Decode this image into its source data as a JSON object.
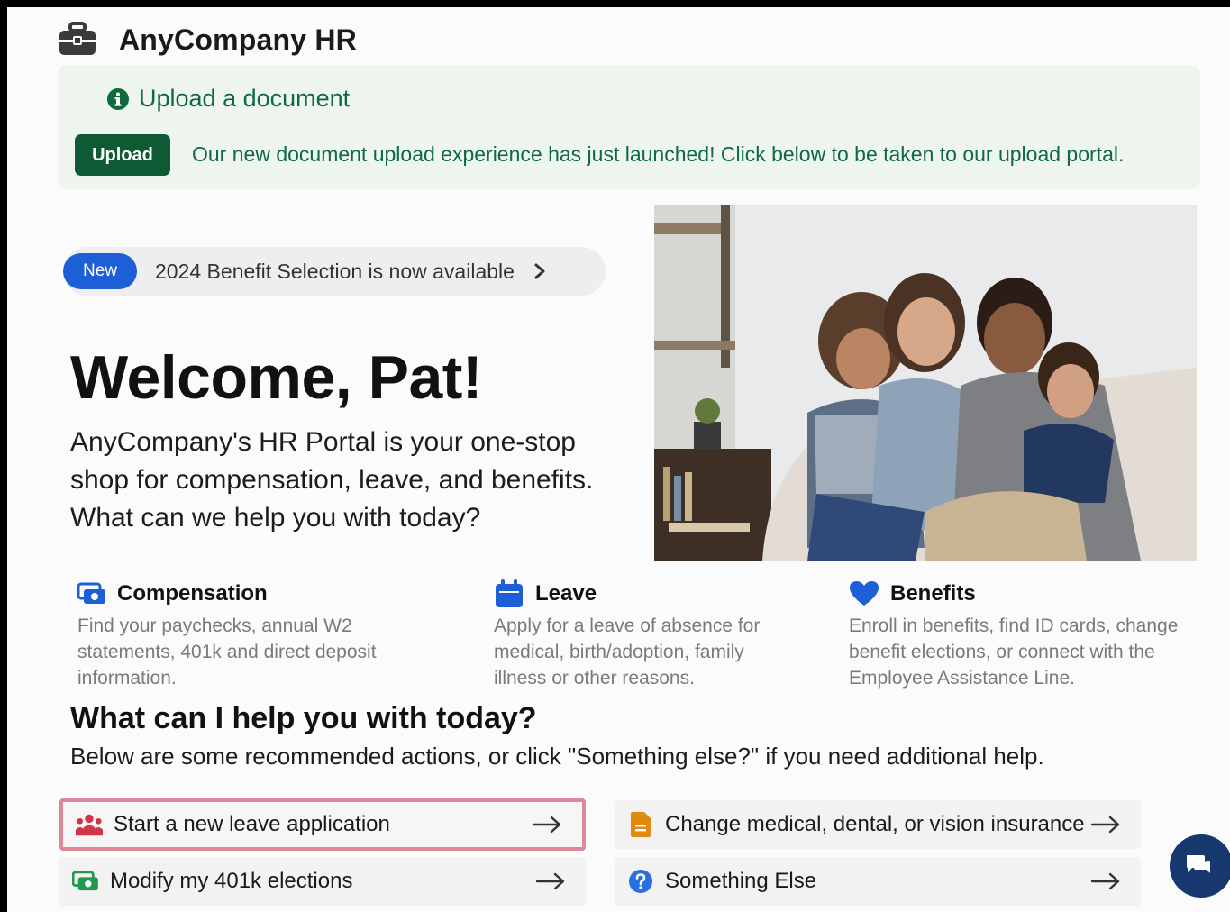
{
  "header": {
    "title": "AnyCompany HR",
    "icon": "briefcase-icon"
  },
  "alert": {
    "title": "Upload a document",
    "button_label": "Upload",
    "message": "Our new document upload experience has just launched! Click below to be taken to our upload portal.",
    "colors": {
      "background": "#eef5ef",
      "text": "#0f6a3c",
      "button": "#0e5a35"
    }
  },
  "announcement": {
    "badge": "New",
    "text": "2024 Benefit Selection is now available",
    "badge_color": "#1d5fd6"
  },
  "welcome": {
    "heading": "Welcome, Pat!",
    "intro_lines": [
      "AnyCompany's HR Portal is your one-stop",
      "shop for compensation, leave, and benefits.",
      "What can we help you with today?"
    ]
  },
  "categories": [
    {
      "title": "Compensation",
      "icon": "money-icon",
      "lines": [
        "Find your paychecks, annual W2",
        "statements, 401k and direct deposit",
        "information."
      ]
    },
    {
      "title": "Leave",
      "icon": "calendar-icon",
      "lines": [
        "Apply for a leave of absence for",
        "medical, birth/adoption, family",
        "illness or other reasons."
      ]
    },
    {
      "title": "Benefits",
      "icon": "heart-icon",
      "lines": [
        "Enroll in benefits, find ID cards, change",
        "benefit elections, or connect with the",
        "Employee Assistance Line."
      ]
    }
  ],
  "help": {
    "title": "What can I help you with today?",
    "subtitle": "Below are some recommended actions, or click \"Something else?\" if you need additional help."
  },
  "actions": [
    {
      "label": "Start a new leave application",
      "icon": "people-icon",
      "selected": true
    },
    {
      "label": "Change medical, dental, or vision insurance",
      "icon": "document-icon",
      "selected": false
    },
    {
      "label": "Modify my 401k elections",
      "icon": "money-icon",
      "selected": false
    },
    {
      "label": "Something Else",
      "icon": "question-icon",
      "selected": false
    }
  ],
  "chat": {
    "icon": "chat-icon"
  }
}
